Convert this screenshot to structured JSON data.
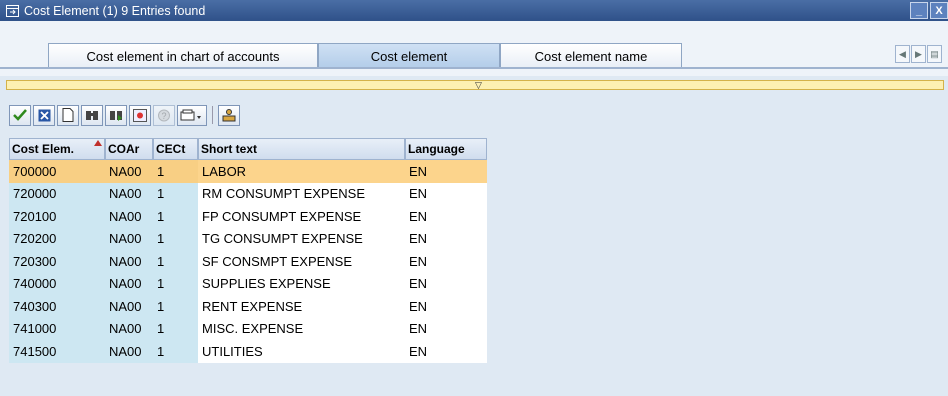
{
  "window": {
    "title": "Cost Element (1)   9 Entries found",
    "minimize_label": "_",
    "close_label": "X"
  },
  "tabs": [
    {
      "label": "Cost element in chart of accounts",
      "active": false
    },
    {
      "label": "Cost element",
      "active": true
    },
    {
      "label": "Cost element name",
      "active": false
    }
  ],
  "toolbar": {
    "icons": [
      "check-icon",
      "cancel-icon",
      "new-page-icon",
      "find-icon",
      "find-next-icon",
      "settings-icon",
      "help-icon",
      "print-icon",
      "personal-list-icon"
    ]
  },
  "table": {
    "columns": [
      "Cost Elem.",
      "COAr",
      "CECt",
      "Short text",
      "Language"
    ],
    "rows": [
      {
        "cost_elem": "700000",
        "coar": "NA00",
        "cect": "1",
        "short_text": "LABOR",
        "language": "EN",
        "selected": true
      },
      {
        "cost_elem": "720000",
        "coar": "NA00",
        "cect": "1",
        "short_text": "RM CONSUMPT EXPENSE",
        "language": "EN"
      },
      {
        "cost_elem": "720100",
        "coar": "NA00",
        "cect": "1",
        "short_text": "FP CONSUMPT EXPENSE",
        "language": "EN"
      },
      {
        "cost_elem": "720200",
        "coar": "NA00",
        "cect": "1",
        "short_text": "TG CONSUMPT EXPENSE",
        "language": "EN"
      },
      {
        "cost_elem": "720300",
        "coar": "NA00",
        "cect": "1",
        "short_text": "SF CONSMPT EXPENSE",
        "language": "EN"
      },
      {
        "cost_elem": "740000",
        "coar": "NA00",
        "cect": "1",
        "short_text": "SUPPLIES EXPENSE",
        "language": "EN"
      },
      {
        "cost_elem": "740300",
        "coar": "NA00",
        "cect": "1",
        "short_text": "RENT EXPENSE",
        "language": "EN"
      },
      {
        "cost_elem": "741000",
        "coar": "NA00",
        "cect": "1",
        "short_text": "MISC. EXPENSE",
        "language": "EN"
      },
      {
        "cost_elem": "741500",
        "coar": "NA00",
        "cect": "1",
        "short_text": "UTILITIES",
        "language": "EN"
      }
    ]
  },
  "colors": {
    "titlebar": "#2f5189",
    "selected_row": "#fcd48c",
    "key_column": "#cde7f2"
  }
}
